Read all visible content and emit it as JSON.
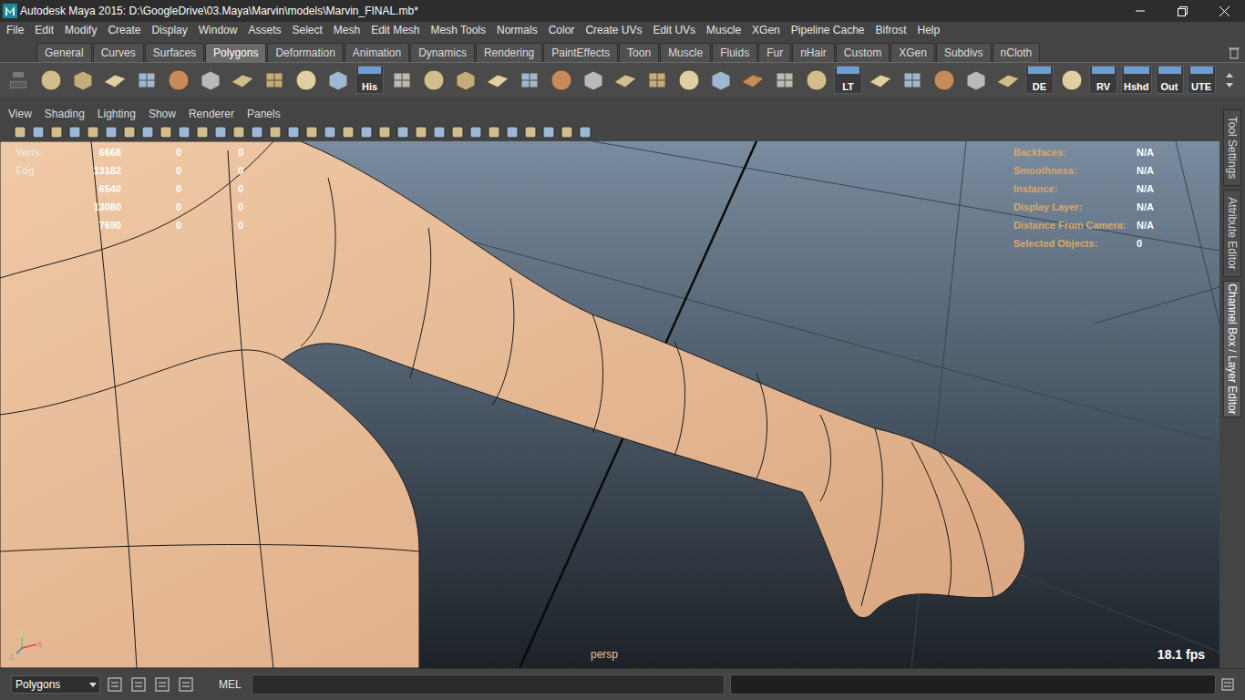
{
  "window": {
    "title": "Autodesk Maya 2015: D:\\GoogleDrive\\03.Maya\\Marvin\\models\\Marvin_FINAL.mb*"
  },
  "menu": [
    "File",
    "Edit",
    "Modify",
    "Create",
    "Display",
    "Window",
    "Assets",
    "Select",
    "Mesh",
    "Edit Mesh",
    "Mesh Tools",
    "Normals",
    "Color",
    "Create UVs",
    "Edit UVs",
    "Muscle",
    "XGen",
    "Pipeline Cache",
    "Bifrost",
    "Help"
  ],
  "shelf_tabs": [
    {
      "label": "General",
      "selected": false
    },
    {
      "label": "Curves",
      "selected": false
    },
    {
      "label": "Surfaces",
      "selected": false
    },
    {
      "label": "Polygons",
      "selected": true
    },
    {
      "label": "Deformation",
      "selected": false
    },
    {
      "label": "Animation",
      "selected": false
    },
    {
      "label": "Dynamics",
      "selected": false
    },
    {
      "label": "Rendering",
      "selected": false
    },
    {
      "label": "PaintEffects",
      "selected": false
    },
    {
      "label": "Toon",
      "selected": false
    },
    {
      "label": "Muscle",
      "selected": false
    },
    {
      "label": "Fluids",
      "selected": false
    },
    {
      "label": "Fur",
      "selected": false
    },
    {
      "label": "nHair",
      "selected": false
    },
    {
      "label": "Custom",
      "selected": false
    },
    {
      "label": "XGen",
      "selected": false
    },
    {
      "label": "Subdivs",
      "selected": false
    },
    {
      "label": "nCloth",
      "selected": false
    }
  ],
  "shelf_items": [
    {
      "kind": "icon"
    },
    {
      "kind": "icon"
    },
    {
      "kind": "icon"
    },
    {
      "kind": "icon"
    },
    {
      "kind": "icon"
    },
    {
      "kind": "icon"
    },
    {
      "kind": "icon"
    },
    {
      "kind": "icon"
    },
    {
      "kind": "icon"
    },
    {
      "kind": "icon"
    },
    {
      "kind": "label",
      "label": "His"
    },
    {
      "kind": "icon"
    },
    {
      "kind": "icon"
    },
    {
      "kind": "icon"
    },
    {
      "kind": "icon"
    },
    {
      "kind": "icon"
    },
    {
      "kind": "icon"
    },
    {
      "kind": "icon"
    },
    {
      "kind": "icon"
    },
    {
      "kind": "icon"
    },
    {
      "kind": "icon"
    },
    {
      "kind": "icon"
    },
    {
      "kind": "icon"
    },
    {
      "kind": "icon"
    },
    {
      "kind": "icon"
    },
    {
      "kind": "label",
      "label": "LT"
    },
    {
      "kind": "icon"
    },
    {
      "kind": "icon"
    },
    {
      "kind": "icon"
    },
    {
      "kind": "icon"
    },
    {
      "kind": "icon"
    },
    {
      "kind": "label",
      "label": "DE"
    },
    {
      "kind": "icon"
    },
    {
      "kind": "label",
      "label": "RV"
    },
    {
      "kind": "label",
      "label": "Hshd"
    },
    {
      "kind": "label",
      "label": "Out"
    },
    {
      "kind": "label",
      "label": "UTE"
    }
  ],
  "panel_menu": [
    "View",
    "Shading",
    "Lighting",
    "Show",
    "Renderer",
    "Panels"
  ],
  "hud_left": [
    {
      "label": "Verts:",
      "values": [
        "6668",
        "0",
        "0"
      ]
    },
    {
      "label": "Edg",
      "values": [
        "13182",
        "0",
        "0"
      ]
    },
    {
      "values": [
        "6540",
        "0",
        "0"
      ]
    },
    {
      "values": [
        "13080",
        "0",
        "0"
      ]
    },
    {
      "values": [
        "7690",
        "0",
        "0"
      ]
    }
  ],
  "hud_right": [
    {
      "label": "Backfaces:",
      "value": "N/A"
    },
    {
      "label": "Smoothness:",
      "value": "N/A"
    },
    {
      "label": "Instance:",
      "value": "N/A"
    },
    {
      "label": "Display Layer:",
      "value": "N/A"
    },
    {
      "label": "Distance From Camera:",
      "value": "N/A"
    },
    {
      "label": "Selected Objects:",
      "value": "0"
    }
  ],
  "camera": "persp",
  "fps": "18.1 fps",
  "axes": {
    "y": "y",
    "x": "x",
    "z": "z"
  },
  "side_tabs": [
    {
      "label": "Tool Settings",
      "selected": false
    },
    {
      "label": "Attribute Editor",
      "selected": false
    },
    {
      "label": "Channel Box / Layer Editor",
      "selected": true
    }
  ],
  "command_line": {
    "mode": "Polygons",
    "language": "MEL"
  }
}
